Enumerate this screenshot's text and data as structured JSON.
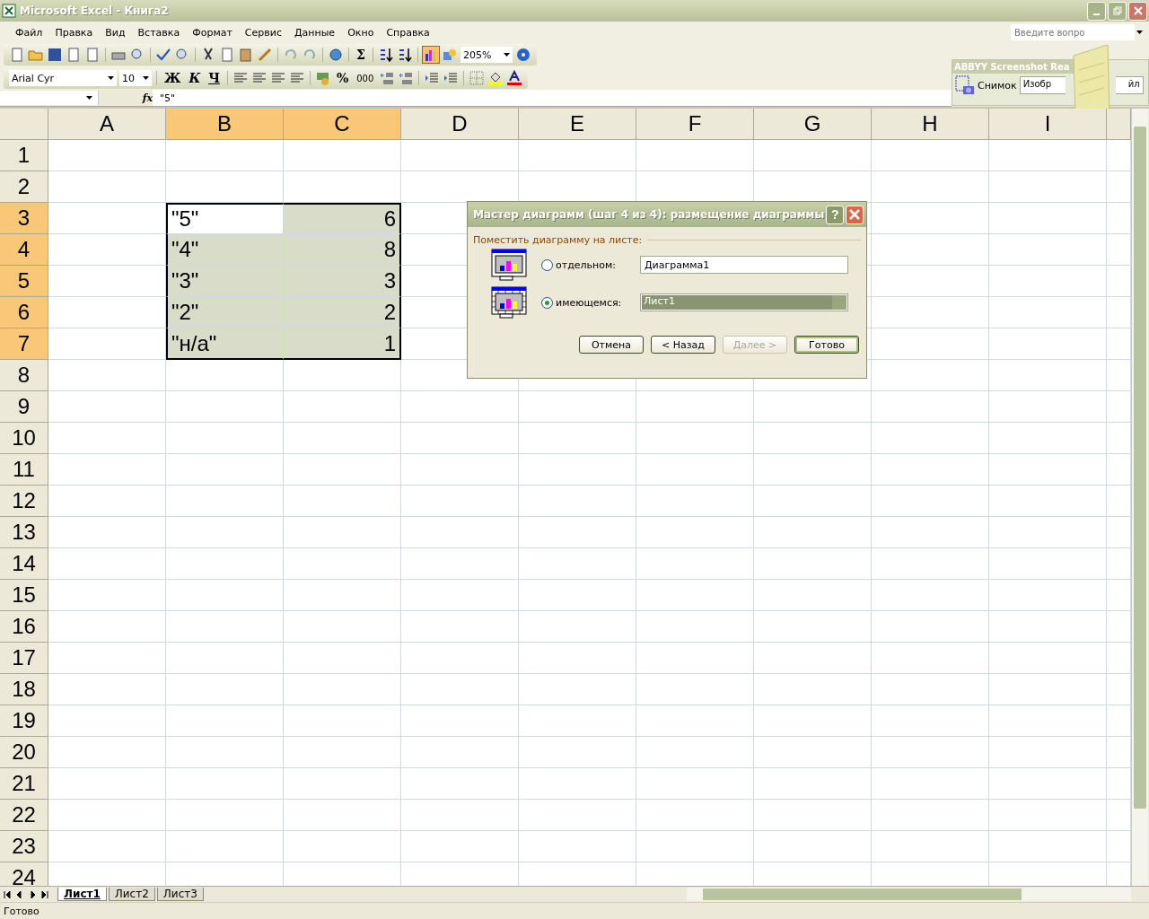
{
  "window": {
    "title": "Microsoft Excel - Книга2"
  },
  "menu": [
    "Файл",
    "Правка",
    "Вид",
    "Вставка",
    "Формат",
    "Сервис",
    "Данные",
    "Окно",
    "Справка"
  ],
  "help_box": {
    "placeholder": "Введите вопро"
  },
  "toolbar_standard": {
    "sum": "Σ",
    "zoom": "205%"
  },
  "toolbar_formatting": {
    "font": "Arial Cyr",
    "size": "10",
    "bold": "Ж",
    "italic": "К",
    "underline": "Ч",
    "percent": "%",
    "thousands": "000"
  },
  "abbyy_panel": {
    "title": "ABBYY Screenshot Rea",
    "snapshot": "Снимок",
    "field_start": "Изобр",
    "field_end": "йл"
  },
  "formula_bar": {
    "fx": "fx",
    "value": "\"5\""
  },
  "columns": [
    {
      "label": "A",
      "selected": false
    },
    {
      "label": "B",
      "selected": true
    },
    {
      "label": "C",
      "selected": true
    },
    {
      "label": "D",
      "selected": false
    },
    {
      "label": "E",
      "selected": false
    },
    {
      "label": "F",
      "selected": false
    },
    {
      "label": "G",
      "selected": false
    },
    {
      "label": "H",
      "selected": false
    },
    {
      "label": "I",
      "selected": false
    }
  ],
  "rows": [
    {
      "header": "1",
      "selected": false
    },
    {
      "header": "2",
      "selected": false
    },
    {
      "header": "3",
      "selected": true,
      "cells": [
        {
          "text": "\"5\"",
          "kind": "text",
          "active": true
        },
        {
          "text": "6",
          "kind": "number",
          "active": false
        }
      ]
    },
    {
      "header": "4",
      "selected": true,
      "cells": [
        {
          "text": "\"4\"",
          "kind": "text",
          "active": false
        },
        {
          "text": "8",
          "kind": "number",
          "active": false
        }
      ]
    },
    {
      "header": "5",
      "selected": true,
      "cells": [
        {
          "text": "\"3\"",
          "kind": "text",
          "active": false
        },
        {
          "text": "3",
          "kind": "number",
          "active": false
        }
      ]
    },
    {
      "header": "6",
      "selected": true,
      "cells": [
        {
          "text": "\"2\"",
          "kind": "text",
          "active": false
        },
        {
          "text": "2",
          "kind": "number",
          "active": false
        }
      ]
    },
    {
      "header": "7",
      "selected": true,
      "cells": [
        {
          "text": "\"н/а\"",
          "kind": "text",
          "active": false
        },
        {
          "text": "1",
          "kind": "number",
          "active": false
        }
      ]
    },
    {
      "header": "8",
      "selected": false
    },
    {
      "header": "9",
      "selected": false
    },
    {
      "header": "10",
      "selected": false
    },
    {
      "header": "11",
      "selected": false
    },
    {
      "header": "12",
      "selected": false
    },
    {
      "header": "13",
      "selected": false
    },
    {
      "header": "14",
      "selected": false
    },
    {
      "header": "15",
      "selected": false
    },
    {
      "header": "16",
      "selected": false
    },
    {
      "header": "17",
      "selected": false
    },
    {
      "header": "18",
      "selected": false
    },
    {
      "header": "19",
      "selected": false
    },
    {
      "header": "20",
      "selected": false
    },
    {
      "header": "21",
      "selected": false
    },
    {
      "header": "22",
      "selected": false
    },
    {
      "header": "23",
      "selected": false
    },
    {
      "header": "24",
      "selected": false
    }
  ],
  "dialog": {
    "title": "Мастер диаграмм (шаг 4 из 4): размещение диаграммы",
    "help": "?",
    "group_label": "Поместить диаграмму на листе:",
    "options": [
      {
        "label": "отдельном:",
        "selected": false,
        "kind": "text",
        "value": "Диаграмма1"
      },
      {
        "label": "имеющемся:",
        "selected": true,
        "kind": "dropdown",
        "value": "Лист1"
      }
    ],
    "buttons": [
      {
        "label": "Отмена",
        "disabled": false,
        "default": false
      },
      {
        "label": "< Назад",
        "disabled": false,
        "default": false
      },
      {
        "label": "Далее >",
        "disabled": true,
        "default": false
      },
      {
        "label": "Готово",
        "disabled": false,
        "default": true
      }
    ]
  },
  "sheet_tabs": [
    {
      "label": "Лист1",
      "selected": true
    },
    {
      "label": "Лист2",
      "selected": false
    },
    {
      "label": "Лист3",
      "selected": false
    }
  ],
  "status_bar": {
    "text": "Готово"
  }
}
